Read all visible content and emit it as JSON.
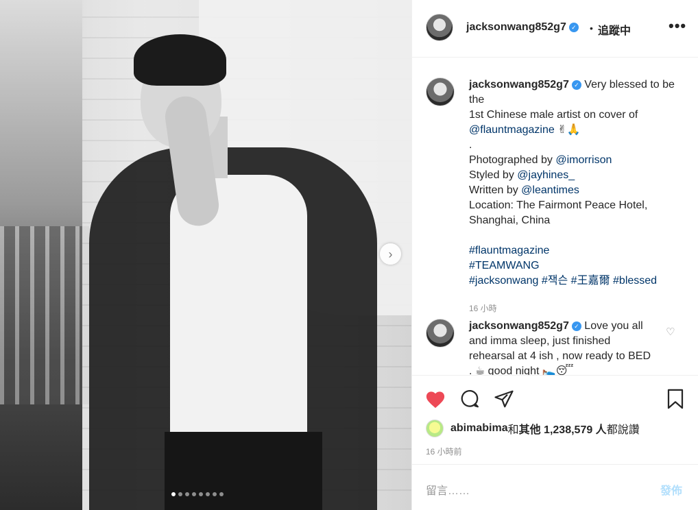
{
  "post": {
    "carousel": {
      "total": 8,
      "active": 1
    },
    "next_icon": "chevron-right-icon"
  },
  "header": {
    "username": "jacksonwang852g7",
    "verified_icon": "verified-badge-icon",
    "separator": "•",
    "follow_status": "追蹤中",
    "more_icon": "more-options-icon",
    "more_label": "•••"
  },
  "caption": {
    "username": "jacksonwang852g7",
    "line1": "Very blessed to be the",
    "line2": "1st Chinese male artist on cover of",
    "mention_magazine": "@flauntmagazine",
    "emoji1": "✌🙏",
    "dot": ".",
    "photographed_prefix": "Photographed by ",
    "photographer": "@imorrison",
    "styled_prefix": "Styled by ",
    "stylist": "@jayhines_",
    "written_prefix": "Written by ",
    "writer": "@leantimes",
    "location": "Location: The Fairmont Peace Hotel, Shanghai, China",
    "hashtag1": "#flauntmagazine",
    "hashtag2": "#TEAMWANG",
    "hashtag3": "#jacksonwang",
    "hashtag4": "#잭슨",
    "hashtag5": "#王嘉爾",
    "hashtag6": "#blessed",
    "time": "16 小時"
  },
  "comment1": {
    "username": "jacksonwang852g7",
    "text": "Love you all and imma sleep, just finished rehearsal at 4 ish , now ready to BED . ☕ good night 🛌😴"
  },
  "actions": {
    "like_icon": "heart-filled-icon",
    "comment_icon": "comment-icon",
    "share_icon": "share-icon",
    "save_icon": "bookmark-icon",
    "like_color": "#ed4956"
  },
  "likes": {
    "first_user": "abimabima",
    "conj": " 和 ",
    "others": "其他 1,238,579 人",
    "suffix": " 都說讚"
  },
  "post_time": "16 小時前",
  "add_comment": {
    "placeholder": "留言……",
    "post_label": "發佈"
  }
}
